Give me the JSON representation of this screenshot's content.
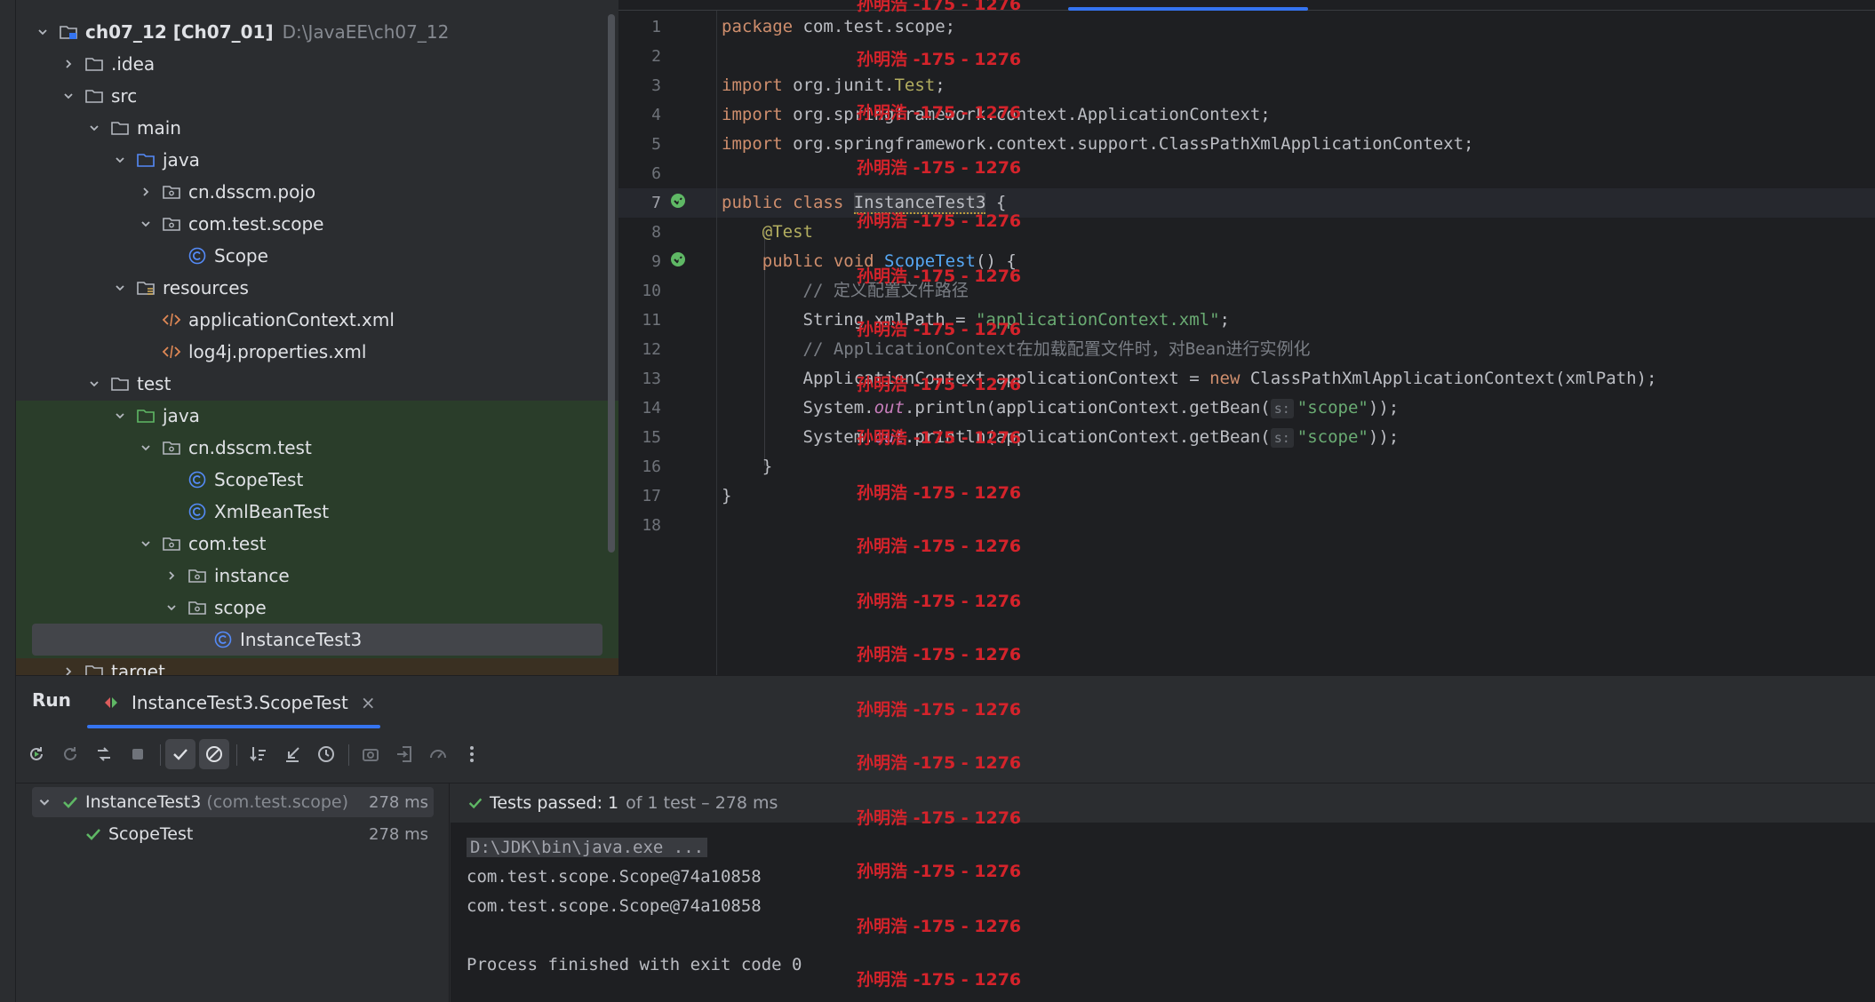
{
  "project_tree": {
    "items": [
      {
        "label": "ch07_12 [Ch07_01]",
        "hint": "D:\\JavaEE\\ch07_12",
        "depth": 0,
        "chevron": "down",
        "icon": "module-folder-icon",
        "bold": true
      },
      {
        "label": ".idea",
        "depth": 1,
        "chevron": "right",
        "icon": "folder-icon"
      },
      {
        "label": "src",
        "depth": 1,
        "chevron": "down",
        "icon": "folder-icon"
      },
      {
        "label": "main",
        "depth": 2,
        "chevron": "down",
        "icon": "folder-icon"
      },
      {
        "label": "java",
        "depth": 3,
        "chevron": "down",
        "icon": "source-folder-icon"
      },
      {
        "label": "cn.dsscm.pojo",
        "depth": 4,
        "chevron": "right",
        "icon": "package-icon"
      },
      {
        "label": "com.test.scope",
        "depth": 4,
        "chevron": "down",
        "icon": "package-icon"
      },
      {
        "label": "Scope",
        "depth": 5,
        "chevron": "none",
        "icon": "class-icon"
      },
      {
        "label": "resources",
        "depth": 3,
        "chevron": "down",
        "icon": "resources-folder-icon"
      },
      {
        "label": "applicationContext.xml",
        "depth": 4,
        "chevron": "none",
        "icon": "xml-file-icon"
      },
      {
        "label": "log4j.properties.xml",
        "depth": 4,
        "chevron": "none",
        "icon": "xml-file-icon"
      },
      {
        "label": "test",
        "depth": 2,
        "chevron": "down",
        "icon": "folder-icon"
      },
      {
        "label": "java",
        "depth": 3,
        "chevron": "down",
        "icon": "test-folder-icon"
      },
      {
        "label": "cn.dsscm.test",
        "depth": 4,
        "chevron": "down",
        "icon": "package-icon"
      },
      {
        "label": "ScopeTest",
        "depth": 5,
        "chevron": "none",
        "icon": "class-icon"
      },
      {
        "label": "XmlBeanTest",
        "depth": 5,
        "chevron": "none",
        "icon": "class-icon"
      },
      {
        "label": "com.test",
        "depth": 4,
        "chevron": "down",
        "icon": "package-icon"
      },
      {
        "label": "instance",
        "depth": 5,
        "chevron": "right",
        "icon": "package-icon"
      },
      {
        "label": "scope",
        "depth": 5,
        "chevron": "down",
        "icon": "package-icon"
      },
      {
        "label": "InstanceTest3",
        "depth": 6,
        "chevron": "none",
        "icon": "class-icon",
        "selected": true
      },
      {
        "label": "target",
        "depth": 1,
        "chevron": "right",
        "icon": "folder-icon"
      }
    ]
  },
  "editor": {
    "line_numbers": [
      "1",
      "2",
      "3",
      "4",
      "5",
      "6",
      "7",
      "8",
      "9",
      "10",
      "11",
      "12",
      "13",
      "14",
      "15",
      "16",
      "17",
      "18"
    ],
    "current_line": "7",
    "lines": [
      [
        {
          "t": "package ",
          "c": "kw"
        },
        {
          "t": "com.test.scope;"
        }
      ],
      [],
      [
        {
          "t": "import ",
          "c": "kw"
        },
        {
          "t": "org.junit."
        },
        {
          "t": "Test",
          "c": "ann"
        },
        {
          "t": ";"
        }
      ],
      [
        {
          "t": "import ",
          "c": "kw"
        },
        {
          "t": "org.springframework.context.ApplicationContext;"
        }
      ],
      [
        {
          "t": "import ",
          "c": "kw"
        },
        {
          "t": "org.springframework.context.support.ClassPathXmlApplicationContext;"
        }
      ],
      [],
      [
        {
          "t": "public class ",
          "c": "kw"
        },
        {
          "t": "InstanceTest3",
          "c": "cls-hl"
        },
        {
          "t": " {"
        }
      ],
      [
        {
          "t": "    "
        },
        {
          "t": "@Test",
          "c": "ann"
        }
      ],
      [
        {
          "t": "    "
        },
        {
          "t": "public void ",
          "c": "kw"
        },
        {
          "t": "ScopeTest",
          "c": "fn"
        },
        {
          "t": "() {"
        }
      ],
      [
        {
          "t": "        "
        },
        {
          "t": "// 定义配置文件路径",
          "c": "cmt"
        }
      ],
      [
        {
          "t": "        String xmlPath = "
        },
        {
          "t": "\"applicationContext.xml\"",
          "c": "str"
        },
        {
          "t": ";"
        }
      ],
      [
        {
          "t": "        "
        },
        {
          "t": "// ApplicationContext在加载配置文件时，对Bean进行实例化",
          "c": "cmt"
        }
      ],
      [
        {
          "t": "        ApplicationContext applicationContext = "
        },
        {
          "t": "new ",
          "c": "kw"
        },
        {
          "t": "ClassPathXmlApplicationContext(xmlPath);"
        }
      ],
      [
        {
          "t": "        System."
        },
        {
          "t": "out",
          "c": "it"
        },
        {
          "t": ".println(applicationContext.getBean("
        },
        {
          "t": "s:",
          "c": "hint"
        },
        {
          "t": "\"scope\"",
          "c": "str"
        },
        {
          "t": "));"
        }
      ],
      [
        {
          "t": "        System."
        },
        {
          "t": "out",
          "c": "it"
        },
        {
          "t": ".println(applicationContext.getBean("
        },
        {
          "t": "s:",
          "c": "hint"
        },
        {
          "t": "\"scope\"",
          "c": "str"
        },
        {
          "t": "));"
        }
      ],
      [
        {
          "t": "    }"
        }
      ],
      [
        {
          "t": "}"
        }
      ],
      []
    ]
  },
  "run_panel": {
    "title": "Run",
    "tab_label": "InstanceTest3.ScopeTest",
    "tab_close": "×",
    "toolbar_icons": [
      "rerun-icon",
      "rerun-failed-icon",
      "toggle-auto-test-icon",
      "stop-icon",
      "show-passed-icon",
      "show-ignored-icon",
      "sort-icon",
      "collapse-icon",
      "history-icon",
      "screenshot-icon",
      "import-icon",
      "coverage-icon",
      "more-icon"
    ],
    "results": [
      {
        "name": "InstanceTest3",
        "pkg": "(com.test.scope)",
        "time": "278 ms"
      },
      {
        "name": "ScopeTest",
        "time": "278 ms"
      }
    ],
    "status_bold": "Tests passed: 1",
    "status_rest": "of 1 test – 278 ms",
    "console": [
      "D:\\JDK\\bin\\java.exe ...",
      "com.test.scope.Scope@74a10858",
      "com.test.scope.Scope@74a10858",
      "",
      "Process finished with exit code 0"
    ]
  },
  "watermark": "孙明浩 -175 - 1276",
  "colors": {
    "accent": "#3574f0",
    "success": "#5fb865",
    "watermark": "#d4232b"
  }
}
